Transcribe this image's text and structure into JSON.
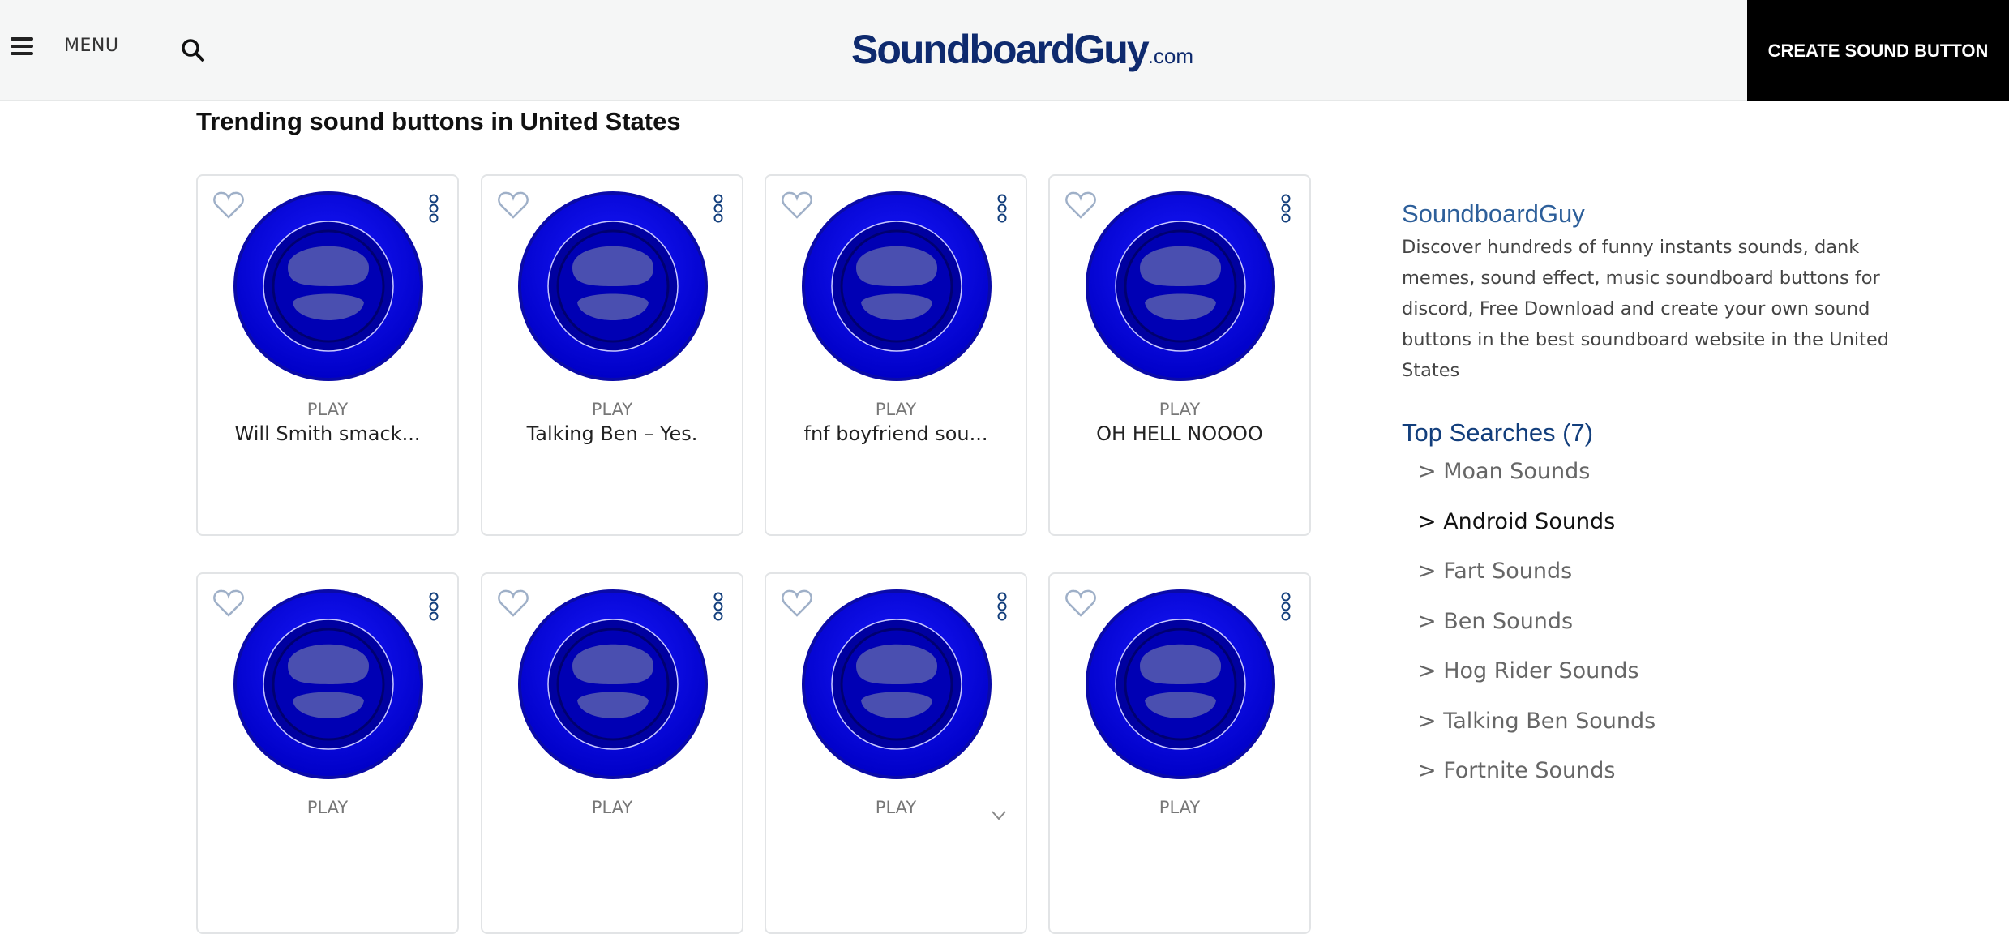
{
  "header": {
    "menu_label": "MENU",
    "logo_main": "SoundboardGuy",
    "logo_tld": ".com",
    "create_label": "CREATE SOUND BUTTON"
  },
  "main": {
    "title": "Trending sound buttons in United States",
    "play_label": "PLAY",
    "cards": [
      {
        "name": "Will Smith smack..."
      },
      {
        "name": "Talking Ben – Yes."
      },
      {
        "name": "fnf boyfriend sou..."
      },
      {
        "name": "OH HELL NOOOO"
      },
      {
        "name": ""
      },
      {
        "name": ""
      },
      {
        "name": ""
      },
      {
        "name": ""
      }
    ]
  },
  "sidebar": {
    "brand": "SoundboardGuy",
    "description": "Discover hundreds of funny instants sounds, dank memes, sound effect, music soundboard buttons for discord, Free Download and create your own sound buttons in the best soundboard website in the United States",
    "top_title": "Top Searches (7)",
    "top_searches": [
      {
        "label": "> Moan Sounds"
      },
      {
        "label": "> Android Sounds",
        "active": true
      },
      {
        "label": "> Fart Sounds"
      },
      {
        "label": "> Ben Sounds"
      },
      {
        "label": "> Hog Rider Sounds"
      },
      {
        "label": "> Talking Ben Sounds"
      },
      {
        "label": "> Fortnite Sounds"
      }
    ]
  },
  "colors": {
    "button_blue": "#0000e6",
    "brand_navy": "#0e2a6e",
    "link_blue": "#2d5f9a"
  }
}
